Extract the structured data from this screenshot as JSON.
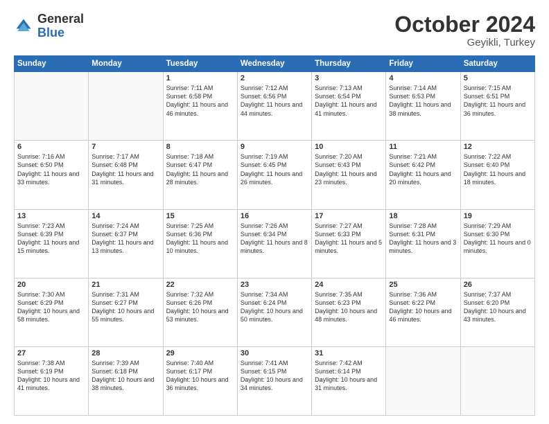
{
  "header": {
    "logo_general": "General",
    "logo_blue": "Blue",
    "month_title": "October 2024",
    "location": "Geyikli, Turkey"
  },
  "days_of_week": [
    "Sunday",
    "Monday",
    "Tuesday",
    "Wednesday",
    "Thursday",
    "Friday",
    "Saturday"
  ],
  "weeks": [
    [
      {
        "num": "",
        "sunrise": "",
        "sunset": "",
        "daylight": "",
        "empty": true
      },
      {
        "num": "",
        "sunrise": "",
        "sunset": "",
        "daylight": "",
        "empty": true
      },
      {
        "num": "1",
        "sunrise": "Sunrise: 7:11 AM",
        "sunset": "Sunset: 6:58 PM",
        "daylight": "Daylight: 11 hours and 46 minutes.",
        "empty": false
      },
      {
        "num": "2",
        "sunrise": "Sunrise: 7:12 AM",
        "sunset": "Sunset: 6:56 PM",
        "daylight": "Daylight: 11 hours and 44 minutes.",
        "empty": false
      },
      {
        "num": "3",
        "sunrise": "Sunrise: 7:13 AM",
        "sunset": "Sunset: 6:54 PM",
        "daylight": "Daylight: 11 hours and 41 minutes.",
        "empty": false
      },
      {
        "num": "4",
        "sunrise": "Sunrise: 7:14 AM",
        "sunset": "Sunset: 6:53 PM",
        "daylight": "Daylight: 11 hours and 38 minutes.",
        "empty": false
      },
      {
        "num": "5",
        "sunrise": "Sunrise: 7:15 AM",
        "sunset": "Sunset: 6:51 PM",
        "daylight": "Daylight: 11 hours and 36 minutes.",
        "empty": false
      }
    ],
    [
      {
        "num": "6",
        "sunrise": "Sunrise: 7:16 AM",
        "sunset": "Sunset: 6:50 PM",
        "daylight": "Daylight: 11 hours and 33 minutes.",
        "empty": false
      },
      {
        "num": "7",
        "sunrise": "Sunrise: 7:17 AM",
        "sunset": "Sunset: 6:48 PM",
        "daylight": "Daylight: 11 hours and 31 minutes.",
        "empty": false
      },
      {
        "num": "8",
        "sunrise": "Sunrise: 7:18 AM",
        "sunset": "Sunset: 6:47 PM",
        "daylight": "Daylight: 11 hours and 28 minutes.",
        "empty": false
      },
      {
        "num": "9",
        "sunrise": "Sunrise: 7:19 AM",
        "sunset": "Sunset: 6:45 PM",
        "daylight": "Daylight: 11 hours and 26 minutes.",
        "empty": false
      },
      {
        "num": "10",
        "sunrise": "Sunrise: 7:20 AM",
        "sunset": "Sunset: 6:43 PM",
        "daylight": "Daylight: 11 hours and 23 minutes.",
        "empty": false
      },
      {
        "num": "11",
        "sunrise": "Sunrise: 7:21 AM",
        "sunset": "Sunset: 6:42 PM",
        "daylight": "Daylight: 11 hours and 20 minutes.",
        "empty": false
      },
      {
        "num": "12",
        "sunrise": "Sunrise: 7:22 AM",
        "sunset": "Sunset: 6:40 PM",
        "daylight": "Daylight: 11 hours and 18 minutes.",
        "empty": false
      }
    ],
    [
      {
        "num": "13",
        "sunrise": "Sunrise: 7:23 AM",
        "sunset": "Sunset: 6:39 PM",
        "daylight": "Daylight: 11 hours and 15 minutes.",
        "empty": false
      },
      {
        "num": "14",
        "sunrise": "Sunrise: 7:24 AM",
        "sunset": "Sunset: 6:37 PM",
        "daylight": "Daylight: 11 hours and 13 minutes.",
        "empty": false
      },
      {
        "num": "15",
        "sunrise": "Sunrise: 7:25 AM",
        "sunset": "Sunset: 6:36 PM",
        "daylight": "Daylight: 11 hours and 10 minutes.",
        "empty": false
      },
      {
        "num": "16",
        "sunrise": "Sunrise: 7:26 AM",
        "sunset": "Sunset: 6:34 PM",
        "daylight": "Daylight: 11 hours and 8 minutes.",
        "empty": false
      },
      {
        "num": "17",
        "sunrise": "Sunrise: 7:27 AM",
        "sunset": "Sunset: 6:33 PM",
        "daylight": "Daylight: 11 hours and 5 minutes.",
        "empty": false
      },
      {
        "num": "18",
        "sunrise": "Sunrise: 7:28 AM",
        "sunset": "Sunset: 6:31 PM",
        "daylight": "Daylight: 11 hours and 3 minutes.",
        "empty": false
      },
      {
        "num": "19",
        "sunrise": "Sunrise: 7:29 AM",
        "sunset": "Sunset: 6:30 PM",
        "daylight": "Daylight: 11 hours and 0 minutes.",
        "empty": false
      }
    ],
    [
      {
        "num": "20",
        "sunrise": "Sunrise: 7:30 AM",
        "sunset": "Sunset: 6:29 PM",
        "daylight": "Daylight: 10 hours and 58 minutes.",
        "empty": false
      },
      {
        "num": "21",
        "sunrise": "Sunrise: 7:31 AM",
        "sunset": "Sunset: 6:27 PM",
        "daylight": "Daylight: 10 hours and 55 minutes.",
        "empty": false
      },
      {
        "num": "22",
        "sunrise": "Sunrise: 7:32 AM",
        "sunset": "Sunset: 6:26 PM",
        "daylight": "Daylight: 10 hours and 53 minutes.",
        "empty": false
      },
      {
        "num": "23",
        "sunrise": "Sunrise: 7:34 AM",
        "sunset": "Sunset: 6:24 PM",
        "daylight": "Daylight: 10 hours and 50 minutes.",
        "empty": false
      },
      {
        "num": "24",
        "sunrise": "Sunrise: 7:35 AM",
        "sunset": "Sunset: 6:23 PM",
        "daylight": "Daylight: 10 hours and 48 minutes.",
        "empty": false
      },
      {
        "num": "25",
        "sunrise": "Sunrise: 7:36 AM",
        "sunset": "Sunset: 6:22 PM",
        "daylight": "Daylight: 10 hours and 46 minutes.",
        "empty": false
      },
      {
        "num": "26",
        "sunrise": "Sunrise: 7:37 AM",
        "sunset": "Sunset: 6:20 PM",
        "daylight": "Daylight: 10 hours and 43 minutes.",
        "empty": false
      }
    ],
    [
      {
        "num": "27",
        "sunrise": "Sunrise: 7:38 AM",
        "sunset": "Sunset: 6:19 PM",
        "daylight": "Daylight: 10 hours and 41 minutes.",
        "empty": false
      },
      {
        "num": "28",
        "sunrise": "Sunrise: 7:39 AM",
        "sunset": "Sunset: 6:18 PM",
        "daylight": "Daylight: 10 hours and 38 minutes.",
        "empty": false
      },
      {
        "num": "29",
        "sunrise": "Sunrise: 7:40 AM",
        "sunset": "Sunset: 6:17 PM",
        "daylight": "Daylight: 10 hours and 36 minutes.",
        "empty": false
      },
      {
        "num": "30",
        "sunrise": "Sunrise: 7:41 AM",
        "sunset": "Sunset: 6:15 PM",
        "daylight": "Daylight: 10 hours and 34 minutes.",
        "empty": false
      },
      {
        "num": "31",
        "sunrise": "Sunrise: 7:42 AM",
        "sunset": "Sunset: 6:14 PM",
        "daylight": "Daylight: 10 hours and 31 minutes.",
        "empty": false
      },
      {
        "num": "",
        "sunrise": "",
        "sunset": "",
        "daylight": "",
        "empty": true
      },
      {
        "num": "",
        "sunrise": "",
        "sunset": "",
        "daylight": "",
        "empty": true
      }
    ]
  ]
}
